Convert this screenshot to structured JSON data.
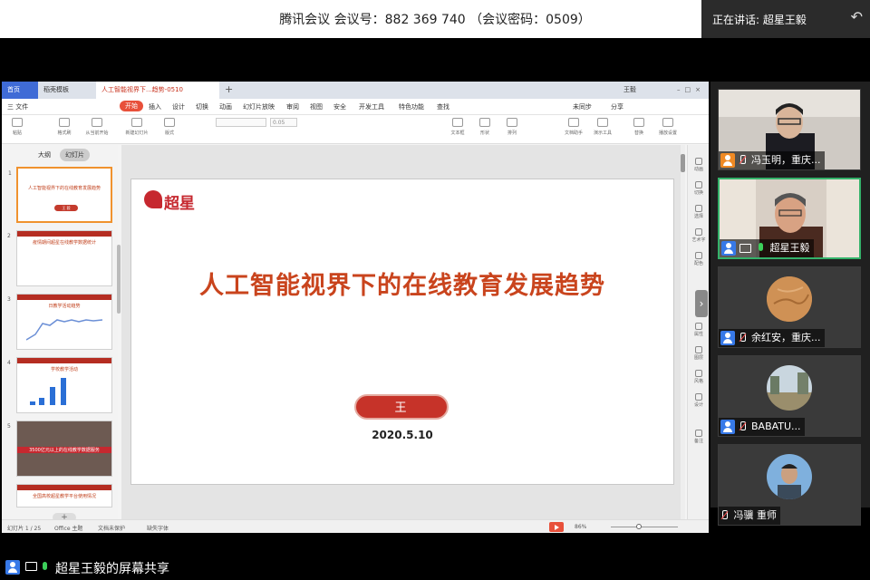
{
  "meeting": {
    "title": "腾讯会议 会议号：882 369 740 （会议密码：0509）",
    "speaking_label": "正在讲话: 超星王毅"
  },
  "wps": {
    "tabs": [
      "首页",
      "稻壳模板",
      "人工智能视界下...趋势-0510"
    ],
    "user": "王毅",
    "menu": [
      "三 文件",
      "开始",
      "插入",
      "设计",
      "切换",
      "动画",
      "幻灯片放映",
      "审阅",
      "视图",
      "安全",
      "开发工具",
      "特色功能",
      "查找"
    ],
    "menu_right": [
      "未同步",
      "分享"
    ],
    "ribbon": [
      "粘贴",
      "格式刷",
      "从当前开始",
      "新建幻灯片",
      "版式",
      "节",
      "重置",
      "文本框",
      "形状",
      "排列",
      "轮廓",
      "文档助手",
      "演示工具",
      "替换",
      "播放设置"
    ],
    "font_size": "0.05",
    "left_tabs": [
      "大纲",
      "幻灯片"
    ],
    "thumbs": [
      {
        "n": "1",
        "text": "人工智能视界下的在线教育发展趋势",
        "button": "王 毅"
      },
      {
        "n": "2",
        "text": "疫情期间超星在线教学数据统计"
      },
      {
        "n": "3",
        "text": "日教学活动趋势"
      },
      {
        "n": "4",
        "text": "学校教学活动"
      },
      {
        "n": "5",
        "text": "3500亿元以上的在线教学数据服务"
      },
      {
        "n": "6",
        "text": "全国高校超星教学平台使用情况"
      }
    ],
    "right_panel": [
      "动画",
      "切换",
      "选择",
      "艺术字",
      "配色",
      "属性",
      "图层",
      "风格",
      "设计",
      "备注"
    ],
    "status": {
      "slide": "幻灯片 1 / 25",
      "theme": "Office 主题",
      "backup": "文档未保护",
      "missing_font": "缺失字体",
      "zoom": "86%"
    }
  },
  "slide": {
    "logo": "超星",
    "title": "人工智能视界下的在线教育发展趋势",
    "presenter": "王 毅",
    "date": "2020.5.10"
  },
  "participants": [
    {
      "name": "冯玉明，重庆...",
      "mic": "off",
      "video": true
    },
    {
      "name": "超星王毅",
      "mic": "on",
      "sharing": true,
      "video": true
    },
    {
      "name": "余红安，重庆...",
      "mic": "off"
    },
    {
      "name": "BABATU...",
      "mic": "off"
    },
    {
      "name": "冯骥 重师",
      "mic": "off"
    }
  ],
  "share_label": "超星王毅的屏幕共享",
  "colors": {
    "accent": "#c9441d",
    "wps_active": "#e8503a",
    "speaking_border": "#34b26a",
    "user_icon": "#3779e8"
  }
}
